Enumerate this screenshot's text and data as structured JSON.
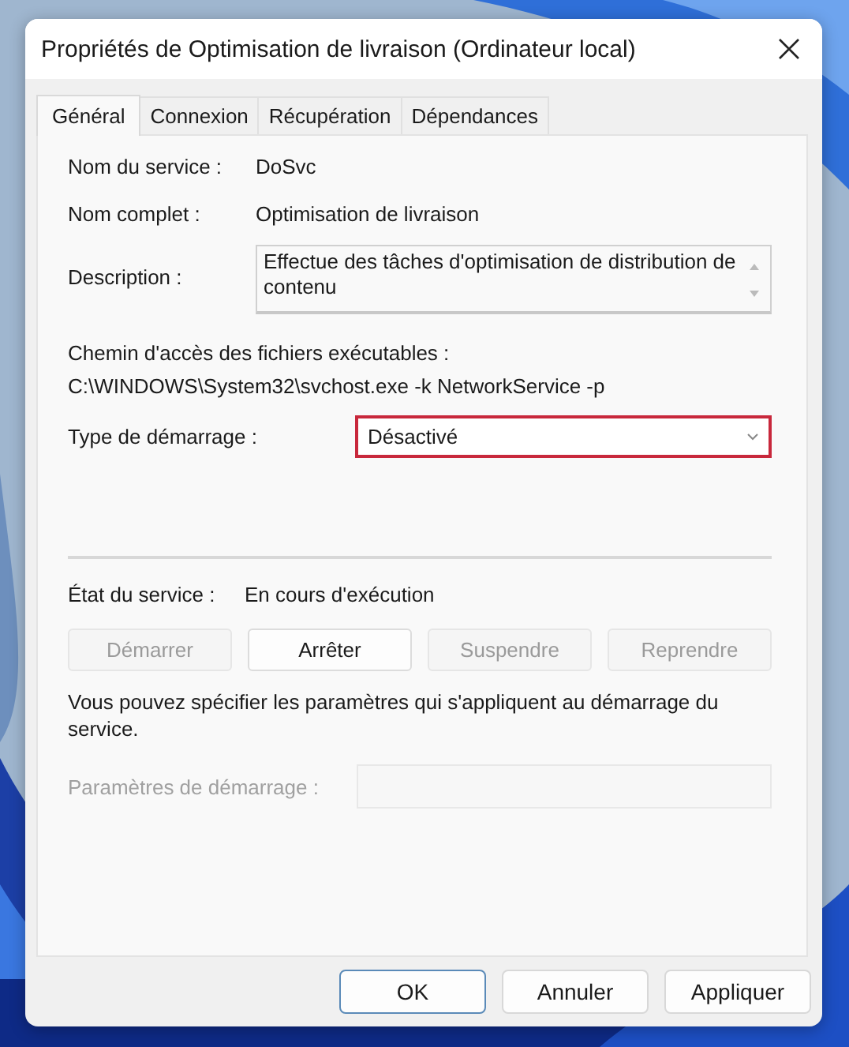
{
  "window": {
    "title": "Propriétés de Optimisation de livraison (Ordinateur local)"
  },
  "tabs": [
    {
      "label": "Général",
      "selected": true
    },
    {
      "label": "Connexion",
      "selected": false
    },
    {
      "label": "Récupération",
      "selected": false
    },
    {
      "label": "Dépendances",
      "selected": false
    }
  ],
  "service_name": {
    "label": "Nom du service :",
    "value": "DoSvc"
  },
  "display_name": {
    "label": "Nom complet :",
    "value": "Optimisation de livraison"
  },
  "description": {
    "label": "Description :",
    "value": "Effectue des tâches d'optimisation de distribution de contenu"
  },
  "path": {
    "label": "Chemin d'accès des fichiers exécutables :",
    "value": "C:\\WINDOWS\\System32\\svchost.exe -k NetworkService -p"
  },
  "startup_type": {
    "label": "Type de démarrage :",
    "value": "Désactivé",
    "highlighted": true
  },
  "service_status": {
    "label": "État du service :",
    "value": "En cours d'exécution"
  },
  "service_buttons": [
    {
      "label": "Démarrer",
      "disabled": true
    },
    {
      "label": "Arrêter",
      "disabled": false
    },
    {
      "label": "Suspendre",
      "disabled": true
    },
    {
      "label": "Reprendre",
      "disabled": true
    }
  ],
  "hint": "Vous pouvez spécifier les paramètres qui s'appliquent au démarrage du service.",
  "start_params": {
    "label": "Paramètres de démarrage :",
    "disabled": true
  },
  "buttons": [
    {
      "label": "OK",
      "default": true
    },
    {
      "label": "Annuler",
      "default": false
    },
    {
      "label": "Appliquer",
      "default": false
    }
  ]
}
